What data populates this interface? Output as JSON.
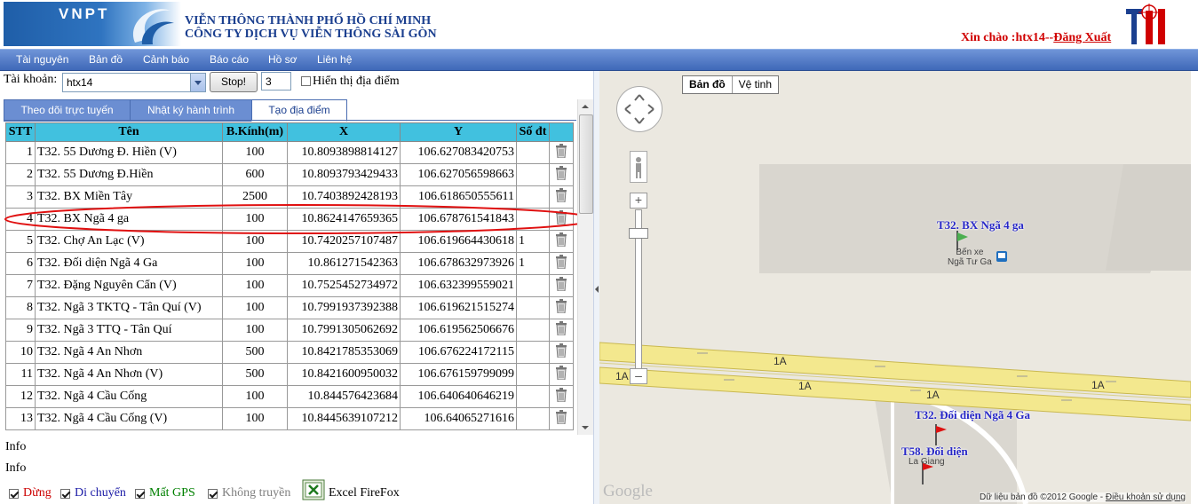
{
  "header": {
    "logo_text": "VNPT",
    "title_line1": "VIỄN THÔNG THÀNH PHỐ HỒ CHÍ MINH",
    "title_line2": "CÔNG TY DỊCH VỤ VIỄN THÔNG SÀI GÒN",
    "greeting": "Xin chào :htx14--",
    "logout": "Đăng Xuất"
  },
  "menu": [
    "Tài nguyên",
    "Bản đồ",
    "Cảnh báo",
    "Báo cáo",
    "Hồ sơ",
    "Liên hệ"
  ],
  "controls": {
    "account_label": "Tài khoản:",
    "account_value": "htx14",
    "stop_button": "Stop!",
    "count_value": "3",
    "show_locations": "Hiển thị địa điểm"
  },
  "tabs": [
    "Theo dõi trực tuyến",
    "Nhật ký hành trình",
    "Tạo địa điểm"
  ],
  "table": {
    "headers": [
      "STT",
      "Tên",
      "B.Kính(m)",
      "X",
      "Y",
      "Số đt",
      ""
    ],
    "rows": [
      [
        "1",
        "T32. 55 Dương Đ. Hiền (V)",
        "100",
        "10.8093898814127",
        "106.627083420753",
        ""
      ],
      [
        "2",
        "T32. 55 Dương Đ.Hiền",
        "600",
        "10.8093793429433",
        "106.627056598663",
        ""
      ],
      [
        "3",
        "T32. BX Miền Tây",
        "2500",
        "10.7403892428193",
        "106.618650555611",
        ""
      ],
      [
        "4",
        "T32. BX Ngã 4 ga",
        "100",
        "10.8624147659365",
        "106.678761541843",
        ""
      ],
      [
        "5",
        "T32. Chợ An Lạc (V)",
        "100",
        "10.7420257107487",
        "106.619664430618",
        "1"
      ],
      [
        "6",
        "T32. Đối diện Ngã 4 Ga",
        "100",
        "10.861271542363",
        "106.678632973926",
        "1"
      ],
      [
        "7",
        "T32. Đặng Nguyên Cẩn (V)",
        "100",
        "10.7525452734972",
        "106.632399559021",
        ""
      ],
      [
        "8",
        "T32. Ngã 3 TKTQ - Tân Quí (V)",
        "100",
        "10.7991937392388",
        "106.619621515274",
        ""
      ],
      [
        "9",
        "T32. Ngã 3 TTQ - Tân Quí",
        "100",
        "10.7991305062692",
        "106.619562506676",
        ""
      ],
      [
        "10",
        "T32. Ngã 4 An Nhơn",
        "500",
        "10.8421785353069",
        "106.676224172115",
        ""
      ],
      [
        "11",
        "T32. Ngã 4 An Nhơn (V)",
        "500",
        "10.8421600950032",
        "106.676159799099",
        ""
      ],
      [
        "12",
        "T32. Ngã 4 Cầu Cống",
        "100",
        "10.844576423684",
        "106.640640646219",
        ""
      ],
      [
        "13",
        "T32. Ngã 4 Cầu Cống (V)",
        "100",
        "10.8445639107212",
        "106.64065271616",
        ""
      ]
    ]
  },
  "info": [
    "Info",
    "Info"
  ],
  "legend": [
    "Dừng",
    "Di chuyển",
    "Mất GPS",
    "Không truyền",
    "Excel FireFox"
  ],
  "legend_colors": [
    "#cc0000",
    "#1a1aa6",
    "#008000",
    "#808080",
    "#000000"
  ],
  "map": {
    "type_map": "Bản đồ",
    "type_satellite": "Vệ tinh",
    "label_station": "T32. BX Ngã 4 ga",
    "poi_station_1": "Bến xe",
    "poi_station_2": "Ngã Tư Ga",
    "label_opposite": "T32. Đối diện Ngã 4 Ga",
    "label_opposite2": "T58. Đối diện",
    "poi_la_giang": "La Giang",
    "road": "1A",
    "copyright": "Dữ liệu bản đồ ©2012 Google - ",
    "terms": "Điều khoản sử dụng",
    "google": "Google"
  }
}
